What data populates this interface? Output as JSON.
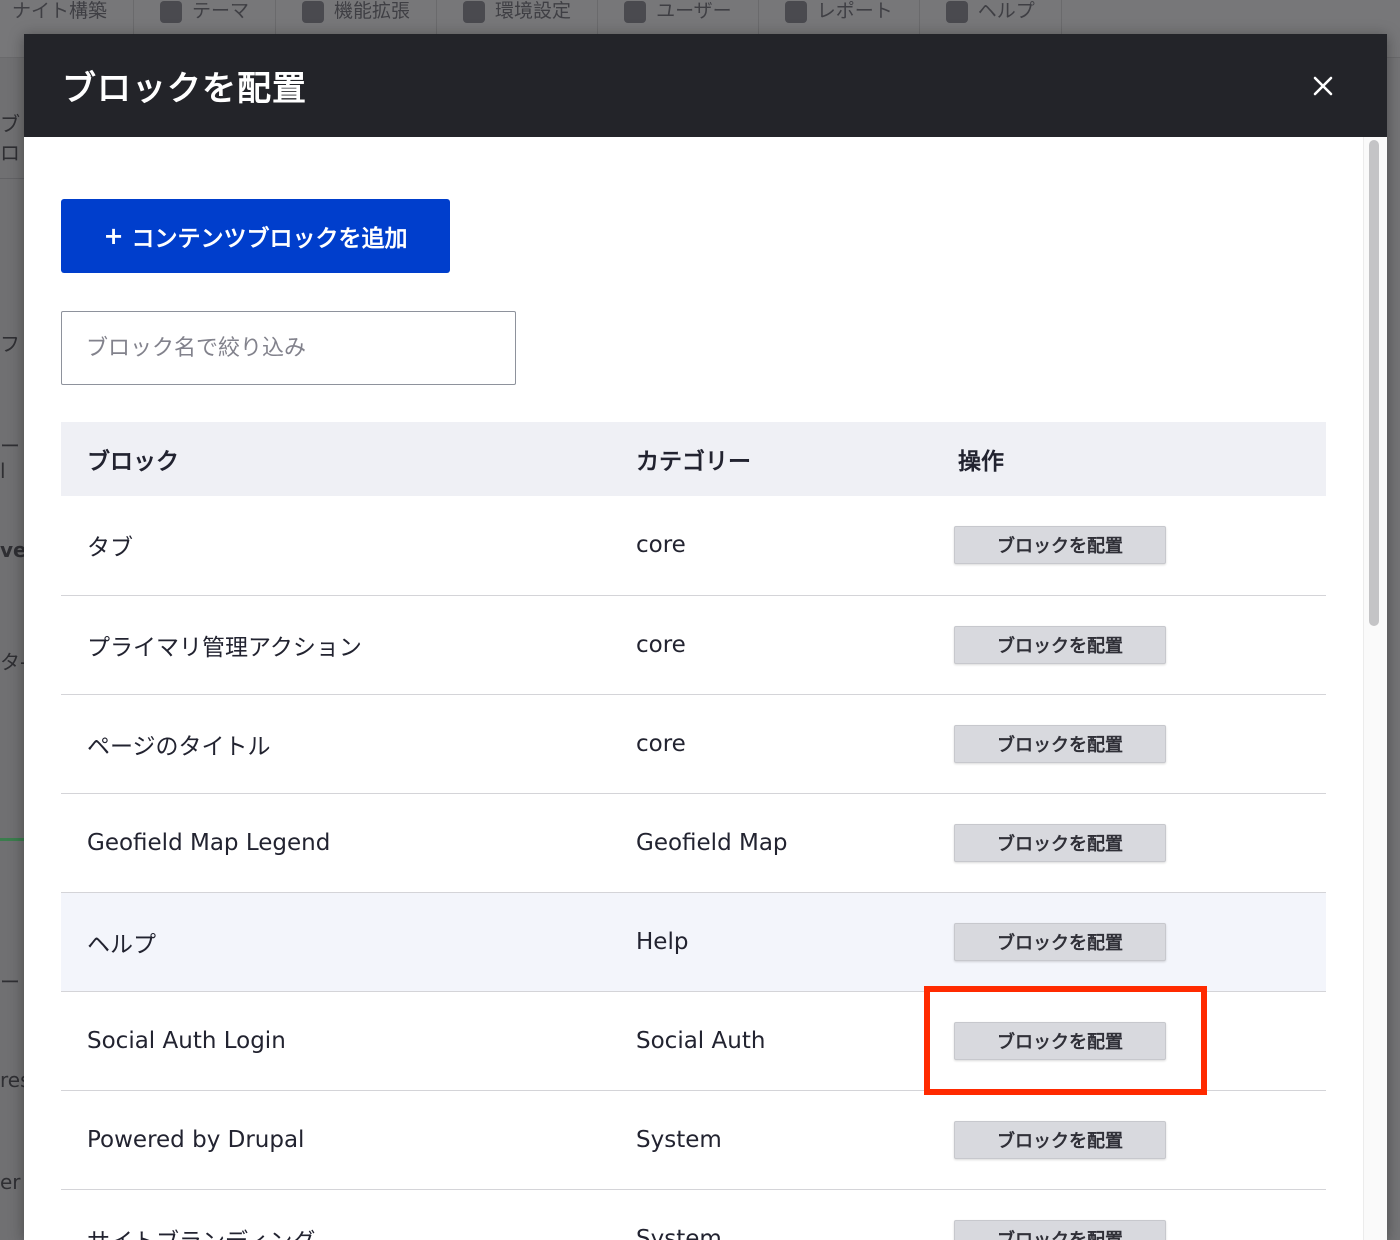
{
  "background": {
    "toolbar_tabs": [
      {
        "label": "ナイト構築",
        "icon": "structure-icon"
      },
      {
        "label": "テーマ",
        "icon": "theme-icon"
      },
      {
        "label": "機能拡張",
        "icon": "extend-icon"
      },
      {
        "label": "環境設定",
        "icon": "config-icon"
      },
      {
        "label": "ユーザー",
        "icon": "people-icon"
      },
      {
        "label": "レポート",
        "icon": "reports-icon"
      },
      {
        "label": "ヘルプ",
        "icon": "help-icon"
      }
    ],
    "left_fragments": [
      "ブロ",
      "フ",
      "ー l",
      "ve",
      "タ-",
      "",
      "ー",
      "res",
      "er"
    ]
  },
  "modal": {
    "title": "ブロックを配置",
    "close_icon": "close-icon",
    "add_button": {
      "plus": "+",
      "label": "コンテンツブロックを追加"
    },
    "filter": {
      "placeholder": "ブロック名で絞り込み",
      "value": ""
    },
    "table": {
      "headers": {
        "block": "ブロック",
        "category": "カテゴリー",
        "operations": "操作"
      },
      "rows": [
        {
          "block": "タブ",
          "category": "core",
          "action": "ブロックを配置"
        },
        {
          "block": "プライマリ管理アクション",
          "category": "core",
          "action": "ブロックを配置"
        },
        {
          "block": "ページのタイトル",
          "category": "core",
          "action": "ブロックを配置"
        },
        {
          "block": "Geofield Map Legend",
          "category": "Geofield Map",
          "action": "ブロックを配置"
        },
        {
          "block": "ヘルプ",
          "category": "Help",
          "action": "ブロックを配置"
        },
        {
          "block": "Social Auth Login",
          "category": "Social Auth",
          "action": "ブロックを配置"
        },
        {
          "block": "Powered by Drupal",
          "category": "System",
          "action": "ブロックを配置"
        },
        {
          "block": "サイトブランディング",
          "category": "System",
          "action": "ブロックを配置"
        }
      ]
    }
  },
  "colors": {
    "header_bg": "#232429",
    "primary_button": "#003ecc",
    "highlight": "#ff2a00"
  }
}
